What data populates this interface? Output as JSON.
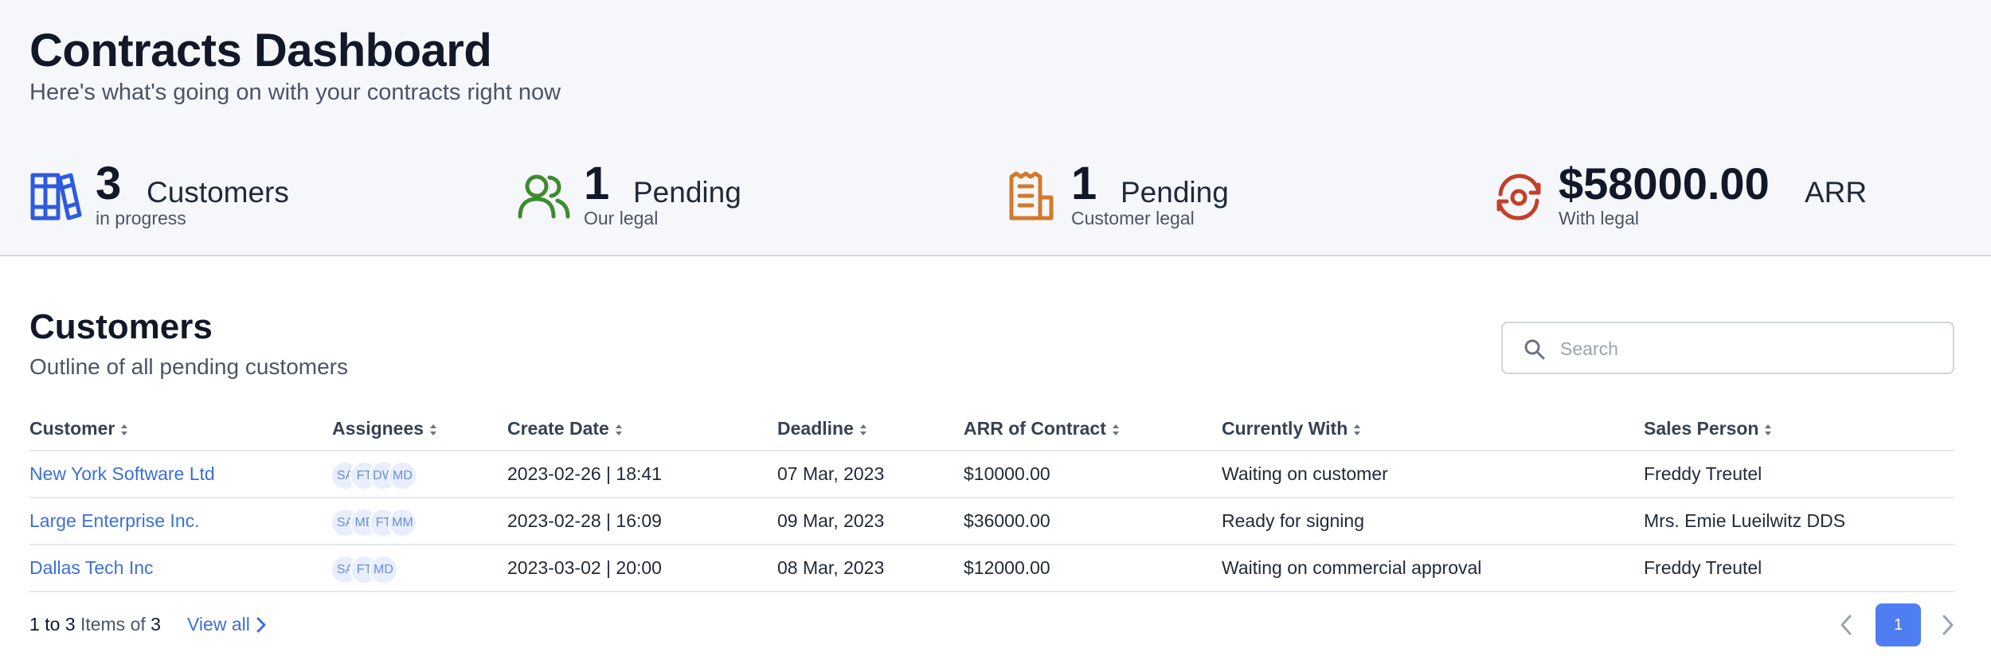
{
  "header": {
    "title": "Contracts Dashboard",
    "subtitle": "Here's what's going on with your contracts right now"
  },
  "stats": [
    {
      "icon": "books-icon",
      "color": "#2f5ae0",
      "value": "3",
      "label": "Customers",
      "sub": "in progress"
    },
    {
      "icon": "users-icon",
      "color": "#3f8a2e",
      "value": "1",
      "label": "Pending",
      "sub": "Our legal"
    },
    {
      "icon": "receipt-icon",
      "color": "#d27a2c",
      "value": "1",
      "label": "Pending",
      "sub": "Customer legal"
    },
    {
      "icon": "refresh-target-icon",
      "color": "#c3402a",
      "value": "$58000.00",
      "label": "ARR",
      "sub": "With legal"
    }
  ],
  "customers_section": {
    "title": "Customers",
    "subtitle": "Outline of all pending customers",
    "search_placeholder": "Search"
  },
  "table": {
    "columns": [
      "Customer",
      "Assignees",
      "Create Date",
      "Deadline",
      "ARR of Contract",
      "Currently With",
      "Sales Person"
    ],
    "rows": [
      {
        "customer": "New York Software Ltd",
        "assignees": [
          "SA",
          "FT",
          "DW",
          "MD"
        ],
        "create_date": "2023-02-26 | 18:41",
        "deadline": "07 Mar, 2023",
        "arr": "$10000.00",
        "currently_with": "Waiting on customer",
        "sales_person": "Freddy Treutel"
      },
      {
        "customer": "Large Enterprise Inc.",
        "assignees": [
          "SA",
          "ME",
          "FT",
          "MM"
        ],
        "create_date": "2023-02-28 | 16:09",
        "deadline": "09 Mar, 2023",
        "arr": "$36000.00",
        "currently_with": "Ready for signing",
        "sales_person": "Mrs. Emie Lueilwitz DDS"
      },
      {
        "customer": "Dallas Tech Inc",
        "assignees": [
          "SA",
          "FT",
          "MD"
        ],
        "create_date": "2023-03-02 | 20:00",
        "deadline": "08 Mar, 2023",
        "arr": "$12000.00",
        "currently_with": "Waiting on commercial approval",
        "sales_person": "Freddy Treutel"
      }
    ]
  },
  "footer": {
    "range_from": "1",
    "range_to_word": "to",
    "range_to": "3",
    "items_of": "Items of",
    "total": "3",
    "view_all": "View all",
    "current_page": "1"
  },
  "colors": {
    "accent": "#4f7df2",
    "link": "#3b6fd6",
    "header_bg": "#f5f7fb"
  }
}
